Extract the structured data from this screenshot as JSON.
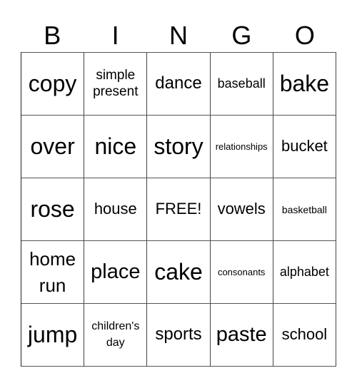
{
  "header": [
    "B",
    "I",
    "N",
    "G",
    "O"
  ],
  "cells": [
    [
      "copy",
      "simple present",
      "dance",
      "baseball",
      "bake"
    ],
    [
      "over",
      "nice",
      "story",
      "relationships",
      "bucket"
    ],
    [
      "rose",
      "house",
      "FREE!",
      "vowels",
      "basketball"
    ],
    [
      "home run",
      "place",
      "cake",
      "consonants",
      "alphabet"
    ],
    [
      "jump",
      "children's day",
      "sports",
      "paste",
      "school"
    ]
  ]
}
